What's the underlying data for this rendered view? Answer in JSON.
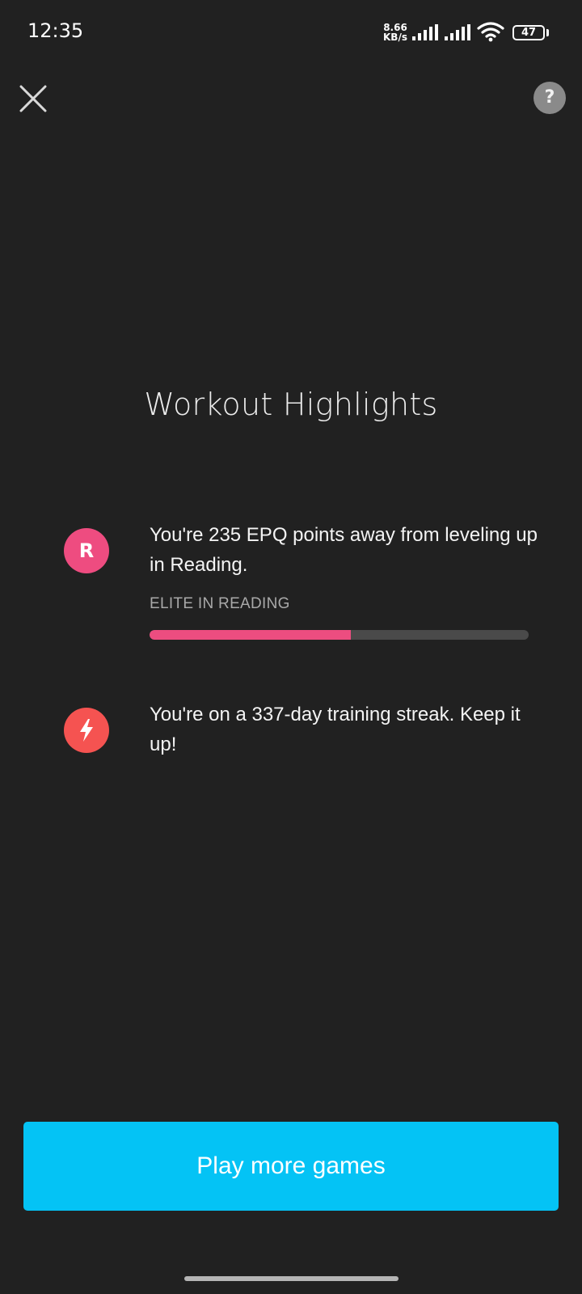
{
  "status_bar": {
    "time": "12:35",
    "net_speed_value": "8.66",
    "net_speed_unit": "KB/s",
    "battery_level": "47"
  },
  "header": {
    "close_icon": "close-icon",
    "help_label": "?"
  },
  "title": "Workout Highlights",
  "highlights": [
    {
      "icon_letter": "R",
      "icon_color": "#ee4c80",
      "text": "You're 235 EPQ points away from leveling up in Reading.",
      "level_label": "ELITE IN READING",
      "progress": 0.53,
      "progress_color": "#ec4d80"
    },
    {
      "icon": "lightning-bolt-icon",
      "icon_color": "#f55351",
      "text": "You're on a 337-day training streak. Keep it up!"
    }
  ],
  "cta": {
    "label": "Play more games",
    "color": "#04c3f5"
  }
}
